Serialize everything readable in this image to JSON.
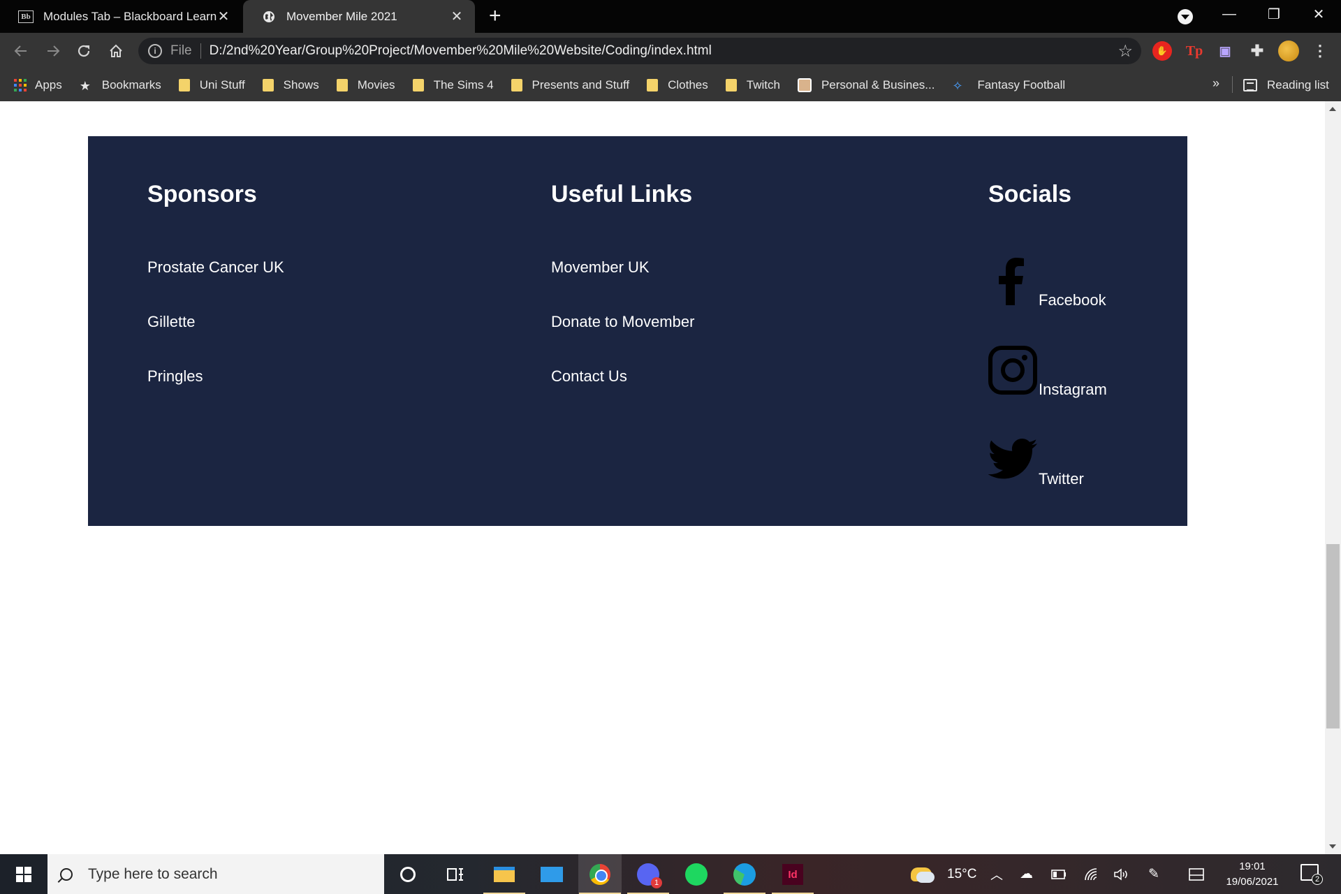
{
  "browser": {
    "tabs": [
      {
        "favicon": "Bb",
        "title": "Modules Tab – Blackboard Learn",
        "close": "✕"
      },
      {
        "favicon": "globe-icon",
        "title": "Movember Mile 2021",
        "close": "✕"
      }
    ],
    "new_tab": "+",
    "address": {
      "scheme": "File",
      "url": "D:/2nd%20Year/Group%20Project/Movember%20Mile%20Website/Coding/index.html"
    },
    "window_controls": {
      "minimize": "—",
      "restore": "❐",
      "close": "✕"
    },
    "extensions": {
      "tp": "Tp"
    },
    "bookmarks": [
      {
        "label": "Apps",
        "icon": "apps-grid-icon"
      },
      {
        "label": "Bookmarks",
        "icon": "star-icon"
      },
      {
        "label": "Uni Stuff",
        "icon": "folder-icon"
      },
      {
        "label": "Shows",
        "icon": "folder-icon"
      },
      {
        "label": "Movies",
        "icon": "folder-icon"
      },
      {
        "label": "The Sims 4",
        "icon": "folder-icon"
      },
      {
        "label": "Presents and Stuff",
        "icon": "folder-icon"
      },
      {
        "label": "Clothes",
        "icon": "folder-icon"
      },
      {
        "label": "Twitch",
        "icon": "folder-icon"
      },
      {
        "label": "Personal & Busines...",
        "icon": "profile-icon"
      },
      {
        "label": "Fantasy Football",
        "icon": "fantasy-football-icon"
      }
    ],
    "bookmarks_more": "»",
    "reading_list": "Reading list"
  },
  "footer": {
    "background": "#1b2541",
    "sponsors": {
      "heading": "Sponsors",
      "items": [
        "Prostate Cancer UK",
        "Gillette",
        "Pringles"
      ]
    },
    "useful_links": {
      "heading": "Useful Links",
      "items": [
        "Movember UK",
        "Donate to Movember",
        "Contact Us"
      ]
    },
    "socials": {
      "heading": "Socials",
      "items": [
        {
          "label": "Facebook",
          "icon": "facebook-icon"
        },
        {
          "label": "Instagram",
          "icon": "instagram-icon"
        },
        {
          "label": "Twitter",
          "icon": "twitter-icon"
        }
      ]
    }
  },
  "taskbar": {
    "search_placeholder": "Type here to search",
    "apps": [
      "cortana-icon",
      "task-view-icon",
      "file-explorer-icon",
      "mail-icon",
      "chrome-icon",
      "discord-icon",
      "spotify-icon",
      "edge-icon",
      "indesign-icon"
    ],
    "discord_badge": "1",
    "indesign_label": "Id",
    "temperature": "15°C",
    "time": "19:01",
    "date": "19/06/2021",
    "notifications": "2"
  }
}
